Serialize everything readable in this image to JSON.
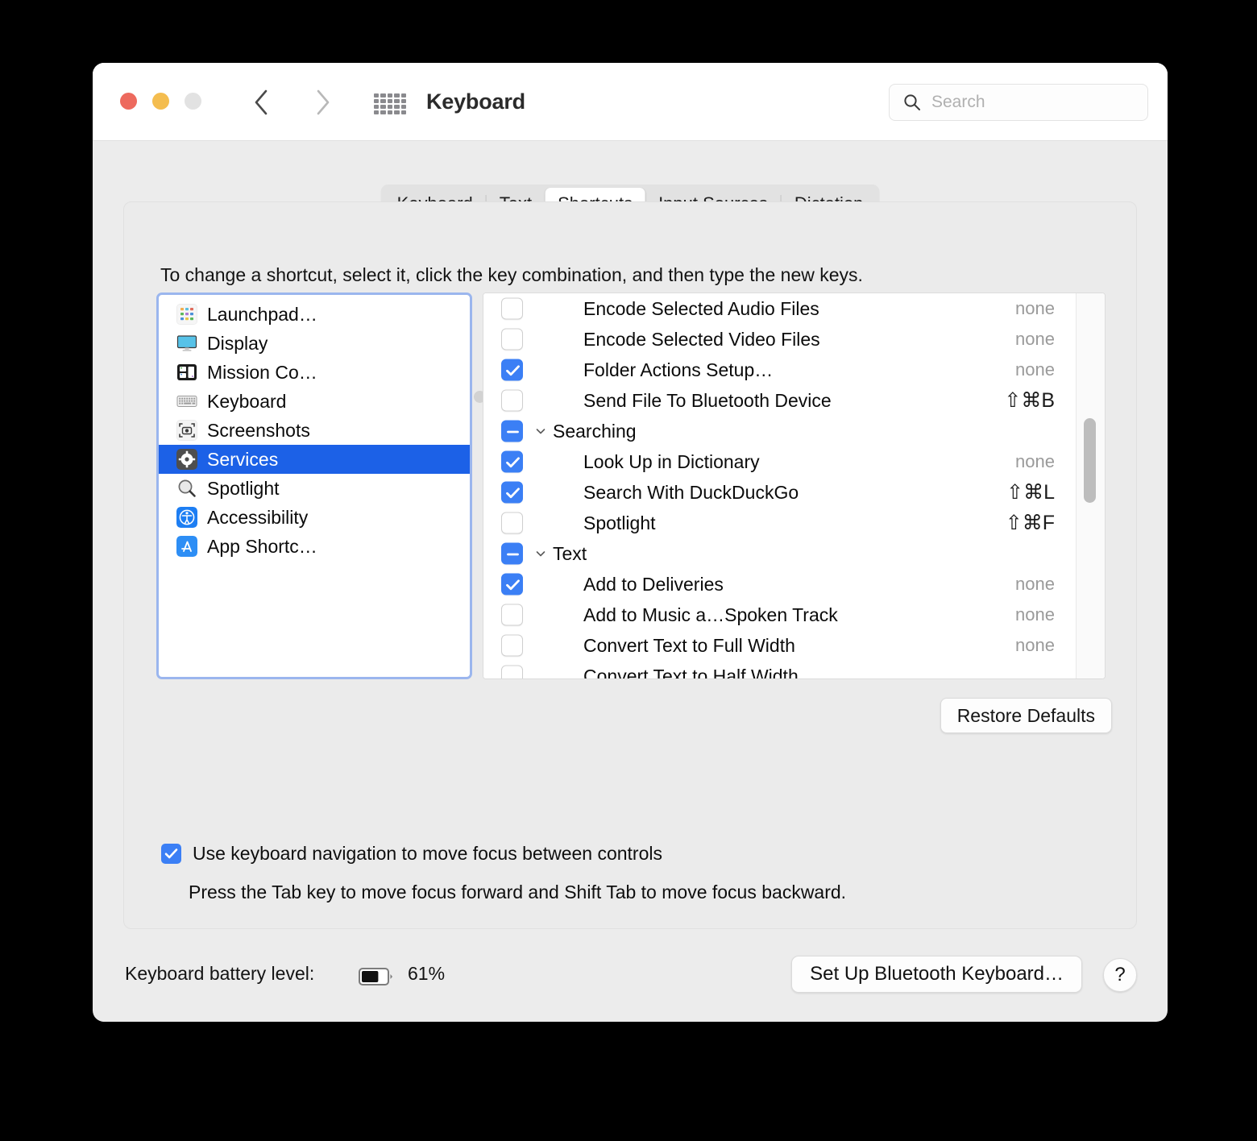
{
  "window": {
    "title": "Keyboard",
    "traffic_lights": [
      "close",
      "minimize",
      "zoom"
    ],
    "nav": {
      "back": "back-chevron",
      "forward": "forward-chevron",
      "grid": "show-all-grid"
    }
  },
  "search": {
    "value": "",
    "placeholder": "Search",
    "icon": "search-icon"
  },
  "tabs": [
    {
      "label": "Keyboard",
      "active": false
    },
    {
      "label": "Text",
      "active": false
    },
    {
      "label": "Shortcuts",
      "active": true
    },
    {
      "label": "Input Sources",
      "active": false
    },
    {
      "label": "Dictation",
      "active": false
    }
  ],
  "instruction": "To change a shortcut, select it, click the key combination, and then type the new keys.",
  "categories": [
    {
      "label": "Launchpad…",
      "icon": "launchpad-icon",
      "selected": false
    },
    {
      "label": "Display",
      "icon": "display-icon",
      "selected": false
    },
    {
      "label": "Mission Co…",
      "icon": "mission-control-icon",
      "selected": false
    },
    {
      "label": "Keyboard",
      "icon": "keyboard-icon",
      "selected": false
    },
    {
      "label": "Screenshots",
      "icon": "screenshots-icon",
      "selected": false
    },
    {
      "label": "Services",
      "icon": "services-gear-icon",
      "selected": true
    },
    {
      "label": "Spotlight",
      "icon": "spotlight-magnifier-icon",
      "selected": false
    },
    {
      "label": "Accessibility",
      "icon": "accessibility-icon",
      "selected": false
    },
    {
      "label": "App Shortc…",
      "icon": "app-shortcuts-icon",
      "selected": false
    }
  ],
  "shortcuts": [
    {
      "name": "Encode Selected Audio Files",
      "key": "none",
      "state": "off",
      "group": false,
      "combo": false
    },
    {
      "name": "Encode Selected Video Files",
      "key": "none",
      "state": "off",
      "group": false,
      "combo": false
    },
    {
      "name": "Folder Actions Setup…",
      "key": "none",
      "state": "on",
      "group": false,
      "combo": false
    },
    {
      "name": "Send File To Bluetooth Device",
      "key": "⇧⌘B",
      "state": "off",
      "group": false,
      "combo": true
    },
    {
      "name": "Searching",
      "key": "",
      "state": "mixed",
      "group": true,
      "combo": false
    },
    {
      "name": "Look Up in Dictionary",
      "key": "none",
      "state": "on",
      "group": false,
      "combo": false
    },
    {
      "name": "Search With DuckDuckGo",
      "key": "⇧⌘L",
      "state": "on",
      "group": false,
      "combo": true
    },
    {
      "name": "Spotlight",
      "key": "⇧⌘F",
      "state": "off",
      "group": false,
      "combo": true
    },
    {
      "name": "Text",
      "key": "",
      "state": "mixed",
      "group": true,
      "combo": false
    },
    {
      "name": "Add to Deliveries",
      "key": "none",
      "state": "on",
      "group": false,
      "combo": false
    },
    {
      "name": "Add to Music a…Spoken Track",
      "key": "none",
      "state": "off",
      "group": false,
      "combo": false
    },
    {
      "name": "Convert Text to Full Width",
      "key": "none",
      "state": "off",
      "group": false,
      "combo": false
    },
    {
      "name": "Convert Text to Half Width",
      "key": "",
      "state": "off",
      "group": false,
      "combo": false
    }
  ],
  "buttons": {
    "restore_defaults": "Restore Defaults",
    "setup_bluetooth": "Set Up Bluetooth Keyboard…",
    "help": "?"
  },
  "keyboard_nav": {
    "checked": true,
    "label": "Use keyboard navigation to move focus between controls",
    "note": "Press the Tab key to move focus forward and Shift Tab to move focus backward."
  },
  "battery": {
    "label": "Keyboard battery level:",
    "percent": "61%",
    "fill_ratio": 0.61,
    "icon": "battery-icon"
  },
  "colors": {
    "accent": "#3b7ff5",
    "selection": "#1c61e7",
    "focus_ring": "#9bb6ee",
    "muted_text": "#9a9a9a"
  }
}
